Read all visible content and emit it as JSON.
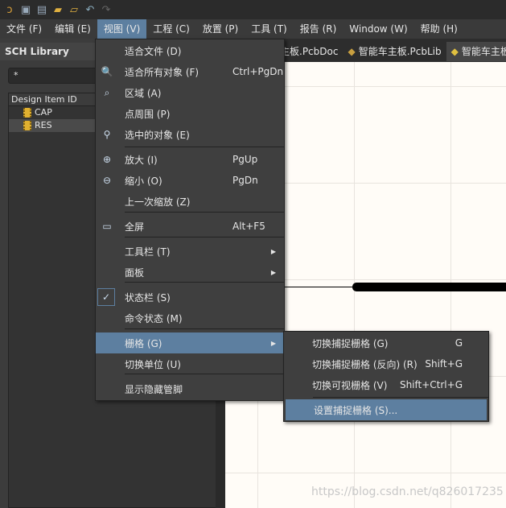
{
  "toolbar": {
    "icons": [
      "app-logo-icon",
      "save-icon",
      "save-all-icon",
      "open-icon",
      "open-project-icon",
      "undo-icon",
      "redo-icon"
    ]
  },
  "menubar": [
    "文件 (F)",
    "编辑 (E)",
    "视图 (V)",
    "工程 (C)",
    "放置 (P)",
    "工具 (T)",
    "报告 (R)",
    "Window (W)",
    "帮助 (H)"
  ],
  "panel": {
    "title": "SCH Library",
    "search": "*",
    "column": "Design Item ID",
    "items": [
      "CAP",
      "RES"
    ]
  },
  "tabs": [
    "主板.PcbDoc",
    "智能车主板.PcbLib",
    "智能车主板"
  ],
  "view_menu": [
    {
      "label": "适合文件 (D)",
      "shortcut": ""
    },
    {
      "label": "适合所有对象 (F)",
      "shortcut": "Ctrl+PgDn"
    },
    {
      "label": "区域 (A)",
      "shortcut": ""
    },
    {
      "label": "点周围 (P)",
      "shortcut": ""
    },
    {
      "label": "选中的对象 (E)",
      "shortcut": ""
    },
    {
      "label": "放大 (I)",
      "shortcut": "PgUp"
    },
    {
      "label": "缩小 (O)",
      "shortcut": "PgDn"
    },
    {
      "label": "上一次缩放 (Z)",
      "shortcut": ""
    },
    {
      "label": "全屏",
      "shortcut": "Alt+F5"
    },
    {
      "label": "工具栏 (T)",
      "shortcut": ""
    },
    {
      "label": "面板",
      "shortcut": ""
    },
    {
      "label": "状态栏 (S)",
      "shortcut": "",
      "checked": true
    },
    {
      "label": "命令状态 (M)",
      "shortcut": ""
    },
    {
      "label": "栅格 (G)",
      "shortcut": ""
    },
    {
      "label": "切换单位 (U)",
      "shortcut": ""
    },
    {
      "label": "显示隐藏管脚",
      "shortcut": ""
    }
  ],
  "grid_submenu": [
    {
      "label": "切换捕捉栅格 (G)",
      "shortcut": "G"
    },
    {
      "label": "切换捕捉栅格 (反向) (R)",
      "shortcut": "Shift+G"
    },
    {
      "label": "切换可视栅格 (V)",
      "shortcut": "Shift+Ctrl+G"
    },
    {
      "label": "设置捕捉栅格 (S)...",
      "shortcut": ""
    }
  ],
  "watermark": "https://blog.csdn.net/q826017235",
  "colors": {
    "highlight": "#5d7fa0",
    "canvas": "#fffcf7"
  }
}
